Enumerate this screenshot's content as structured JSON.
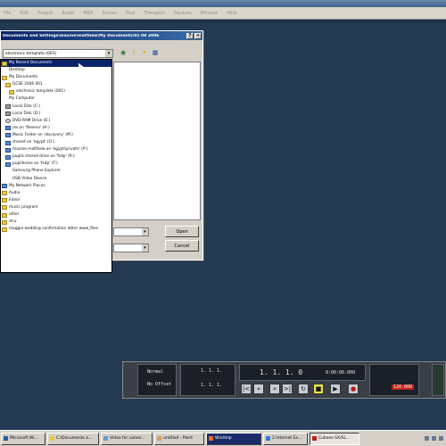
{
  "app_menu": [
    "File",
    "Edit",
    "Project",
    "Audio",
    "MIDI",
    "Scores",
    "Pool",
    "Transport",
    "Devices",
    "Window",
    "Help"
  ],
  "dialog": {
    "title": "Documents and Settings\\maxine\\matthew\\My Documents\\01 08 2006",
    "look_in": "electronic template (001)",
    "buttons": {
      "open": "Open",
      "cancel": "Cancel"
    },
    "location_list": [
      {
        "label": "My Recent Documents",
        "icon": "folder",
        "selected": true
      },
      {
        "label": "Desktop",
        "icon": "desktop"
      },
      {
        "label": "My Documents",
        "icon": "folder"
      },
      {
        "label": "GCSE 2006 001",
        "icon": "folder"
      },
      {
        "label": "electronic template (001)",
        "icon": "folder"
      },
      {
        "label": "My Computer",
        "icon": "desktop"
      },
      {
        "label": "Local Disk (C:)",
        "icon": "drive"
      },
      {
        "label": "Local Disk (D:)",
        "icon": "drive"
      },
      {
        "label": "DVD-RAM Drive (E:)",
        "icon": "dvd"
      },
      {
        "label": "ias on 'fileserv' (H:)",
        "icon": "net"
      },
      {
        "label": "Music Folder on 'discovery' (M:)",
        "icon": "net"
      },
      {
        "label": "shared on 'egypt' (O:)",
        "icon": "net"
      },
      {
        "label": "maxine.matthew on 'egypt\\private' (P:)",
        "icon": "net"
      },
      {
        "label": "pupils shared drive on 'fs4p' (R:)",
        "icon": "net"
      },
      {
        "label": "pupilhome on 'fs4p' (T:)",
        "icon": "net"
      },
      {
        "label": "Samsung Phone Explorer",
        "icon": "desktop"
      },
      {
        "label": "USB Video Device",
        "icon": "desktop"
      },
      {
        "label": "My Network Places",
        "icon": "net"
      },
      {
        "label": "Audio",
        "icon": "folder"
      },
      {
        "label": "Edirol",
        "icon": "folder"
      },
      {
        "label": "music program",
        "icon": "folder"
      },
      {
        "label": "other",
        "icon": "folder"
      },
      {
        "label": "stru",
        "icon": "folder"
      },
      {
        "label": "maggie wedding confirmation letter www_files",
        "icon": "folder"
      }
    ]
  },
  "transport": {
    "left_labels": [
      "Normal",
      "No Offset"
    ],
    "position_primary": "1. 1. 1.",
    "position_secondary": "1. 1. 1.",
    "main_position": "1. 1. 1.  0",
    "time_readout": "0:00:00.000",
    "tempo": "120.000"
  },
  "taskbar": {
    "tasks": [
      {
        "label": "Microsoft Wi...",
        "pressed": false
      },
      {
        "label": "C:\\Documents a...",
        "pressed": false
      },
      {
        "label": "Video for camer...",
        "pressed": false
      },
      {
        "label": "untitled - Paint",
        "pressed": false
      },
      {
        "label": "WinAmp",
        "pressed": false
      },
      {
        "label": "2 Internet Ex...",
        "pressed": false
      },
      {
        "label": "Cubase SX/SL...",
        "pressed": true
      }
    ]
  },
  "colors": {
    "workspace_bg": "#233a52",
    "dialog_bg": "#d4d0c8",
    "title_bar": "#0a246a",
    "selection": "#0a246a"
  }
}
